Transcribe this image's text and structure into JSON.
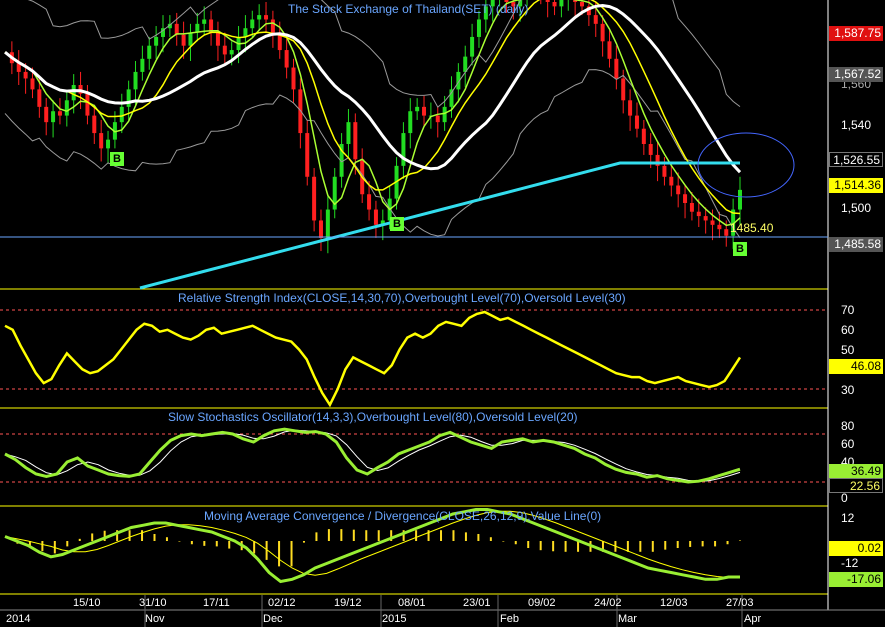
{
  "colors": {
    "background": "#000000",
    "axis_line": "#ffff00",
    "title_text": "#6aa6ff",
    "price_up": "#22dd22",
    "price_down": "#ff2020",
    "ma_fast": "#ffff00",
    "ma_mid": "#aaff33",
    "ma_slow": "#ffffff",
    "ma_long": "#33ddee",
    "bollinger": "#9a9a9a",
    "rsi": "#ffff00",
    "stoch_k": "#99ee33",
    "stoch_d": "#ffffff",
    "macd": "#99ee33",
    "macd_signal": "#ffff00",
    "macd_hist": "#ffdd22",
    "level_dashed": "#ff5555"
  },
  "panels": {
    "price_title": "The Stock Exchange of Thailand(SET) (daily)",
    "rsi_title": "Relative Strength Index(CLOSE,14,30,70),Overbought Level(70),Oversold Level(30)",
    "stoch_title": "Slow Stochastics Oscillator(14,3,3),Overbought Level(80),Oversold Level(20)",
    "macd_title": "Moving Average Convergence / Divergence(CLOSE,26,12,9),Value Line(0)"
  },
  "price": {
    "ticks": [
      "1,540",
      "1,500",
      "1,560",
      "1,587.75"
    ],
    "badges": [
      {
        "text": "1,587.75",
        "bg": "#e01010",
        "fg": "#ffffff"
      },
      {
        "text": "1,567.52",
        "bg": "#555555",
        "fg": "#ffffff"
      },
      {
        "text": "1,526.55",
        "bg": "#000000",
        "fg": "#ffffff"
      },
      {
        "text": "1,514.36",
        "bg": "#ffff00",
        "fg": "#000000"
      },
      {
        "text": "1,485.58",
        "bg": "#555555",
        "fg": "#ffffff"
      }
    ],
    "low_annotation": "1485.40",
    "buy_markers": [
      "B",
      "B",
      "B"
    ]
  },
  "rsi": {
    "ticks": [
      "70",
      "60",
      "50",
      "30"
    ],
    "badge": "46.08"
  },
  "stoch": {
    "ticks": [
      "80",
      "60",
      "40",
      "0"
    ],
    "badges": [
      "36.49",
      "22.56"
    ]
  },
  "macd": {
    "ticks": [
      "12",
      "-12"
    ],
    "badges": [
      "0.02",
      "-17.06"
    ]
  },
  "x_axis": {
    "row1": [
      "15/10",
      "31/10",
      "17/11",
      "02/12",
      "19/12",
      "08/01",
      "23/01",
      "09/02",
      "24/02",
      "12/03",
      "27/03"
    ],
    "row2": [
      "2014",
      "Nov",
      "Dec",
      "2015",
      "Feb",
      "Mar",
      "Apr"
    ]
  },
  "chart_data": {
    "type": "line",
    "note_series": "SET index daily (approx.)",
    "series": [
      {
        "name": "CLOSE",
        "values": [
          1577,
          1572,
          1568,
          1565,
          1560,
          1552,
          1545,
          1550,
          1548,
          1555,
          1562,
          1558,
          1548,
          1540,
          1533,
          1537,
          1545,
          1552,
          1560,
          1568,
          1574,
          1580,
          1584,
          1588,
          1590,
          1585,
          1580,
          1586,
          1590,
          1592,
          1586,
          1580,
          1576,
          1578,
          1584,
          1588,
          1592,
          1594,
          1592,
          1586,
          1578,
          1570,
          1560,
          1540,
          1520,
          1500,
          1492,
          1505,
          1520,
          1535,
          1545,
          1528,
          1512,
          1505,
          1498,
          1500,
          1510,
          1525,
          1540,
          1550,
          1552,
          1548,
          1548,
          1545,
          1552,
          1560,
          1568,
          1575,
          1584,
          1592,
          1598,
          1602,
          1604,
          1600,
          1598,
          1602,
          1606,
          1608,
          1605,
          1600,
          1598,
          1602,
          1605,
          1600,
          1598,
          1594,
          1590,
          1582,
          1574,
          1565,
          1555,
          1548,
          1542,
          1535,
          1530,
          1525,
          1520,
          1516,
          1512,
          1508,
          1504,
          1502,
          1500,
          1498,
          1496,
          1493,
          1505,
          1514
        ]
      },
      {
        "name": "RSI",
        "values": [
          62,
          60,
          52,
          45,
          38,
          33,
          35,
          42,
          48,
          44,
          40,
          38,
          39,
          42,
          45,
          50,
          55,
          60,
          63,
          62,
          59,
          60,
          58,
          56,
          55,
          57,
          60,
          61,
          58,
          59,
          60,
          61,
          62,
          60,
          58,
          56,
          55,
          54,
          50,
          45,
          36,
          28,
          22,
          30,
          40,
          46,
          44,
          42,
          40,
          38,
          42,
          50,
          56,
          58,
          56,
          58,
          62,
          64,
          63,
          62,
          66,
          68,
          69,
          67,
          65,
          66,
          64,
          62,
          60,
          58,
          56,
          54,
          52,
          50,
          48,
          46,
          44,
          42,
          40,
          38,
          37,
          36,
          36,
          34,
          33,
          34,
          35,
          36,
          34,
          33,
          32,
          31,
          32,
          34,
          40,
          46
        ]
      },
      {
        "name": "%K",
        "values": [
          55,
          48,
          38,
          30,
          27,
          30,
          45,
          50,
          40,
          35,
          30,
          28,
          27,
          30,
          45,
          60,
          72,
          78,
          80,
          78,
          80,
          82,
          80,
          74,
          70,
          78,
          84,
          86,
          84,
          82,
          83,
          80,
          70,
          50,
          35,
          30,
          38,
          45,
          55,
          60,
          65,
          70,
          78,
          82,
          76,
          70,
          66,
          62,
          70,
          72,
          74,
          70,
          72,
          70,
          66,
          62,
          55,
          50,
          42,
          36,
          32,
          30,
          26,
          28,
          24,
          22,
          20,
          21,
          24,
          28,
          32,
          36
        ]
      },
      {
        "name": "MACD",
        "values": [
          2,
          0,
          -2,
          -5,
          -7,
          -6,
          -4,
          -2,
          0,
          2,
          4,
          6,
          7,
          8,
          8,
          7,
          6,
          5,
          4,
          2,
          0,
          -3,
          -8,
          -14,
          -18,
          -17,
          -15,
          -12,
          -10,
          -8,
          -6,
          -4,
          -2,
          0,
          2,
          4,
          6,
          8,
          10,
          12,
          13,
          14,
          14,
          13,
          12,
          10,
          8,
          6,
          4,
          2,
          0,
          -2,
          -4,
          -6,
          -8,
          -10,
          -12,
          -13,
          -14,
          -15,
          -16,
          -17,
          -17,
          -16,
          -16
        ]
      }
    ],
    "levels": {
      "rsi_overbought": 70,
      "rsi_oversold": 30,
      "stoch_overbought": 80,
      "stoch_oversold": 20,
      "macd_value_line": 0
    }
  }
}
